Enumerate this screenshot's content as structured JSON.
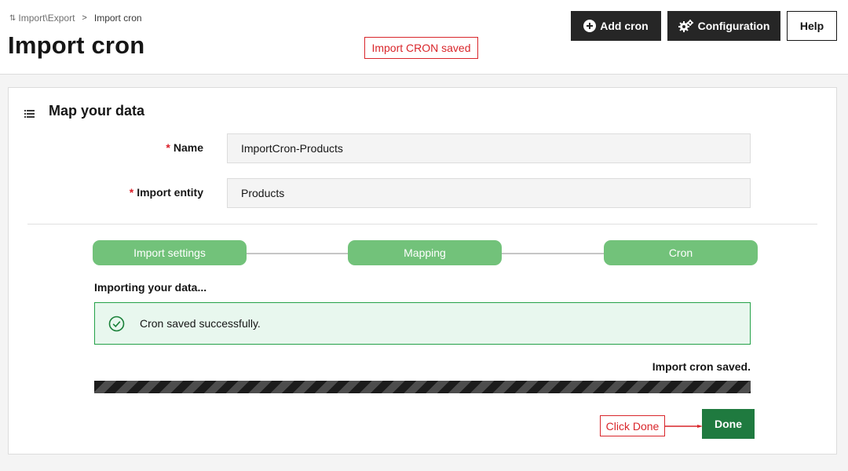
{
  "breadcrumb": {
    "parent": "Import\\Export",
    "separator": ">",
    "current": "Import cron"
  },
  "page_title": "Import cron",
  "toolbar": {
    "add_cron": "Add cron",
    "configuration": "Configuration",
    "help": "Help"
  },
  "annotations": {
    "saved": "Import CRON saved",
    "done_hint": "Click Done"
  },
  "card": {
    "title": "Map your data",
    "fields": {
      "name_label": "Name",
      "name_value": "ImportCron-Products",
      "entity_label": "Import entity",
      "entity_value": "Products",
      "required_mark": "*"
    },
    "steps": [
      "Import settings",
      "Mapping",
      "Cron"
    ],
    "importing_label": "Importing your data...",
    "success_message": "Cron saved successfully.",
    "status_text": "Import cron saved.",
    "progress": 1.0,
    "done_label": "Done"
  },
  "colors": {
    "step_complete": "#72c27a",
    "success_bg": "#e8f7ee",
    "success_border": "#24a148",
    "done_button": "#1f7a3f",
    "annotation": "#d9262b"
  },
  "icons": {
    "breadcrumb": "import-export-icon",
    "add": "plus-circle-icon",
    "config": "gears-icon",
    "list": "list-icon",
    "success": "checkmark-outline-icon"
  }
}
